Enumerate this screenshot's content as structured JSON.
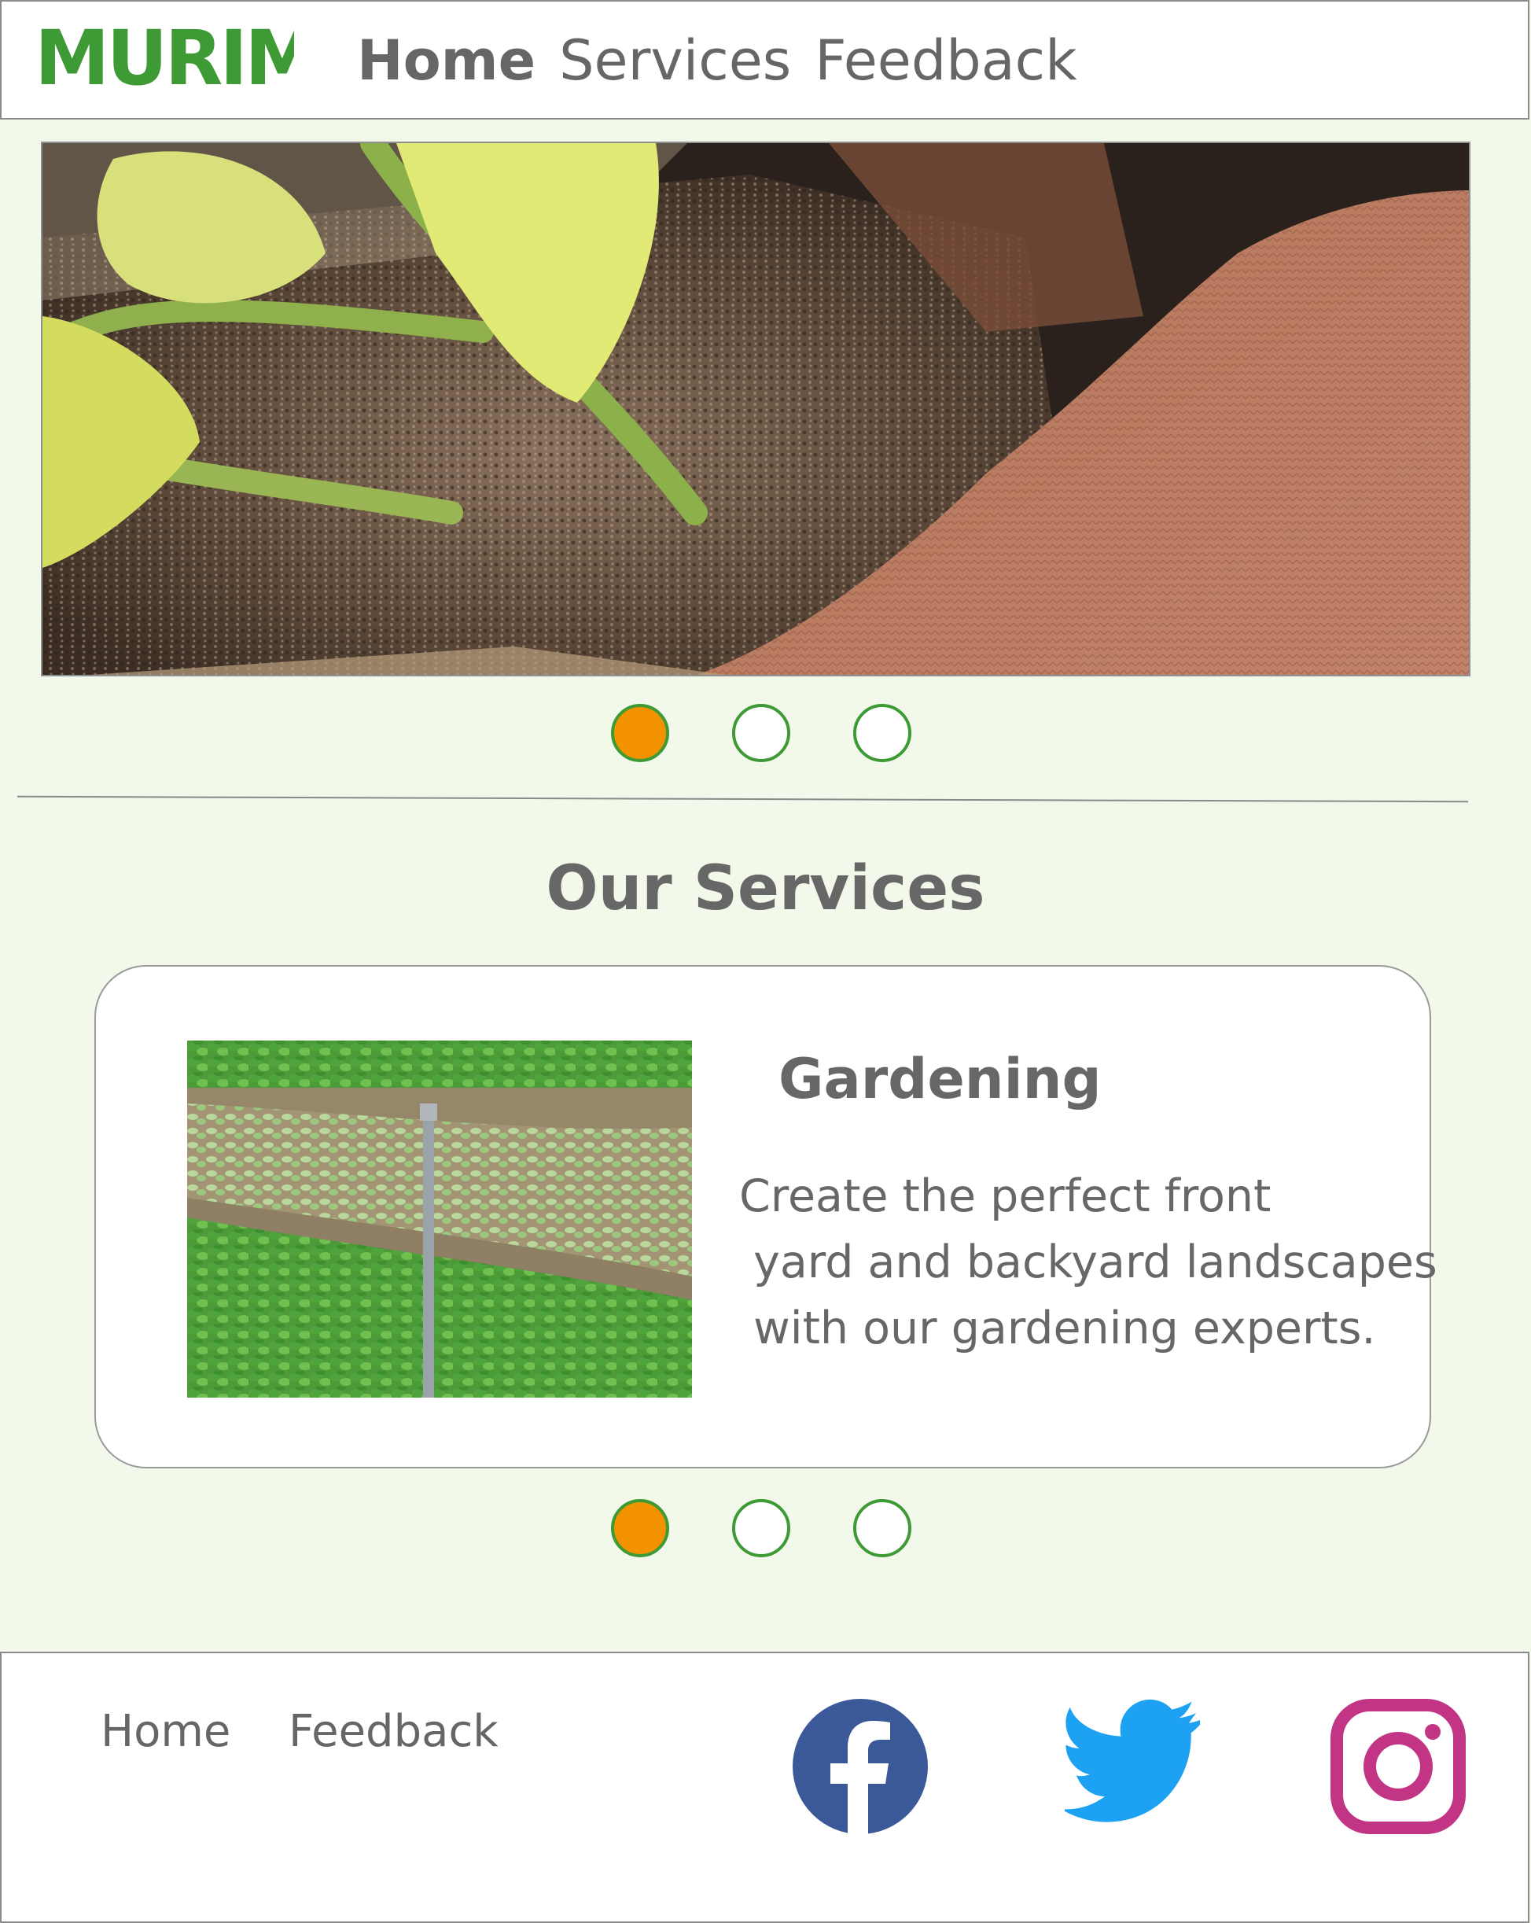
{
  "brand": {
    "logo_text": "MURIMI",
    "color": "#3d9a35"
  },
  "nav": {
    "home": "Home",
    "services": "Services",
    "feedback": "Feedback"
  },
  "hero_carousel": {
    "slide_count": 3,
    "active_index": 0
  },
  "services": {
    "title": "Our Services",
    "card": {
      "title": "Gardening",
      "description_lines": [
        "Create the perfect front",
        " yard and backyard landscapes",
        " with our gardening experts."
      ]
    },
    "slide_count": 3,
    "active_index": 0
  },
  "footer": {
    "links": [
      "Home",
      "Feedback"
    ],
    "social": [
      "facebook-icon",
      "twitter-icon",
      "instagram-icon"
    ]
  },
  "colors": {
    "background": "#f2f8ea",
    "accent": "#f39200",
    "green": "#3d9a35",
    "text": "#666666",
    "facebook": "#3b5998",
    "twitter": "#1da1f2",
    "instagram": "#c13584"
  }
}
